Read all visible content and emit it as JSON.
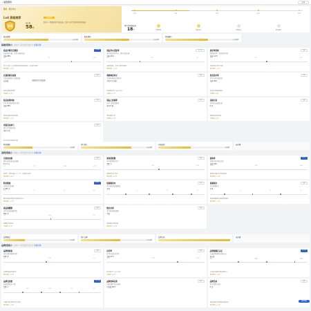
{
  "topbar": {
    "back": "‹ 返回服务",
    "share": "分享"
  },
  "hero": {
    "tag": "我的 · 成长中心",
    "name": "Lv4 高级商家",
    "badge": "V4",
    "score_label": "成长值",
    "score": "58",
    "score_unit": "分",
    "benefit": "权益说明",
    "note": "距离下一等级还需提升成长值，完成下方任务即可获得更多权益",
    "steps": [
      "Lv1",
      "Lv2",
      "Lv3",
      "Lv4",
      "Lv5"
    ],
    "steps_done": 4,
    "progress": 0.34,
    "points_label": "本月可领取权益",
    "points": "18",
    "points_unit": "个",
    "perks": [
      "专属客服",
      "流量扶持",
      "活动报名",
      "更多权益"
    ]
  },
  "group1": {
    "header": "基础经营能力",
    "sub": "完成以下任务提升成长分",
    "link": "查看详情",
    "bars": [
      {
        "label": "商品质量",
        "value": "12/20分",
        "pct": 0.6
      },
      {
        "label": "服务体验",
        "value": "15/25分",
        "pct": 0.6
      },
      {
        "label": "物流履约",
        "value": "17/30分",
        "pct": 0.58
      }
    ],
    "cards": [
      {
        "title": "商品详情页完整度",
        "desc": "完善商品主图、详情与规格信息",
        "metric": "当前 68%",
        "btn": "去完善",
        "ghost": false,
        "ticks": [
          "50",
          "80",
          "100"
        ],
        "points": [
          0.72
        ],
        "foot": "近7天已有 128 家同类商家完成该任务，完成后可提升",
        "gold": "预计提升 +3 分"
      },
      {
        "title": "商品评价回复率",
        "desc": "及时回复买家评价，提升店铺口碑",
        "metric": "当前 42%",
        "btn": "去回复",
        "ghost": true,
        "ticks": [
          "30",
          "60",
          "90"
        ],
        "points": [
          0.35
        ],
        "foot": "回复率越高，买家下单转化越好",
        "gold": "预计提升 +2 分"
      },
      {
        "title": "退货率控制",
        "desc": "降低退货率，保持良好经营",
        "metric": "当前 3.2%",
        "btn": "查看",
        "ghost": true,
        "ticks": [
          "1%",
          "3%",
          "5%"
        ],
        "points": [
          0.6
        ],
        "foot": "退货率低于同行均值",
        "gold": "预计提升 +2 分"
      },
      {
        "title": "店铺装修完成度",
        "desc": "完善店铺首页与品牌形象",
        "metric": "已完成",
        "btn": "查看",
        "ghost": true,
        "mid": "店铺首页已完成装修",
        "foot": "保持店铺形象更新",
        "gold": "已获得 +3 分"
      },
      {
        "title": "客服响应时长",
        "desc": "3分钟内响应买家咨询",
        "metric": "平均 2.1 分钟",
        "btn": "查看",
        "ghost": true,
        "foot": "响应速度优于 85% 同行",
        "gold": "已获得 +2 分"
      },
      {
        "title": "发货及时率",
        "desc": "48小时内完成发货",
        "metric": "当前 96%",
        "btn": "查看",
        "ghost": true,
        "foot": "发货及时率表现良好",
        "gold": "已获得 +4 分"
      },
      {
        "title": "售后处理时效",
        "desc": "24小时内处理售后申请",
        "metric": "当前 88%",
        "btn": "查看",
        "ghost": true,
        "foot": "建议加快售后处理速度",
        "gold": "预计提升 +1 分"
      },
      {
        "title": "商品上新频率",
        "desc": "每月上新商品数量",
        "metric": "本月 6 款",
        "btn": "查看",
        "ghost": true,
        "foot": "保持规律上新",
        "gold": "已获得 +2 分"
      },
      {
        "title": "违规记录",
        "desc": "近90天无违规记录",
        "metric": "0 次",
        "btn": "查看",
        "ghost": true,
        "foot": "继续保持良好经营",
        "gold": "已获得 +5 分"
      },
      {
        "title": "营销活动参与",
        "desc": "参与平台营销活动",
        "metric": "本月 2 次",
        "btn": "查看",
        "ghost": true,
        "foot": "参与更多活动获得流量",
        "gold": "预计提升 +2 分"
      }
    ]
  },
  "group2": {
    "header": "进阶经营能力",
    "sub": "完成以下任务提升成长分",
    "link": "查看详情",
    "bars": [
      {
        "label": "经营规模",
        "value": "8/20分",
        "pct": 0.4
      },
      {
        "label": "用户增长",
        "value": "14/20分",
        "pct": 0.7
      },
      {
        "label": "内容运营",
        "value": "9/20分",
        "pct": 0.45
      },
      {
        "label": "未开通",
        "value": "",
        "pct": 0
      }
    ],
    "cards": [
      {
        "title": "月度成交额",
        "desc": "提升店铺月度成交规模",
        "metric": "¥ 2.3 万",
        "btn": "查看",
        "ghost": true,
        "ticks": [
          "1万",
          "5万",
          "10万",
          "20万"
        ],
        "points": [],
        "foot": "距离下一档位还差 ¥ 2.7 万，完成后可提升",
        "gold": "预计提升 +4 分"
      },
      {
        "title": "新客获取数",
        "desc": "本月新增购买用户",
        "metric": "326 人",
        "btn": "查看",
        "ghost": true,
        "ticks": [
          "100",
          "300",
          "500"
        ],
        "points": [
          0.55
        ],
        "foot": "新客增长优于同行",
        "gold": "预计提升 +2 分"
      },
      {
        "title": "复购率",
        "desc": "老客户再次购买比例",
        "metric": "当前 18%",
        "btn": "去提升",
        "ghost": false,
        "ticks": [
          "10%",
          "20%",
          "30%"
        ],
        "points": [],
        "foot": "复购率可通过会员运营提升",
        "gold": "预计提升 +3 分"
      },
      {
        "title": "粉丝数量",
        "desc": "店铺关注粉丝数",
        "metric": "1,284 人",
        "btn": "去提升",
        "ghost": false,
        "ticks": [
          "500",
          "1k",
          "2k",
          "5k"
        ],
        "points": [],
        "foot": "通过内容运营吸引更多粉丝关注",
        "gold": "预计提升 +2 分"
      },
      {
        "title": "短视频发布",
        "desc": "本月发布短视频数量",
        "metric": "4 条",
        "btn": "查看",
        "ghost": true,
        "ticks": [
          "2",
          "5",
          "10",
          "20"
        ],
        "points": [
          0.2,
          0.45,
          0.7,
          0.9
        ],
        "foot": "",
        "gold": ""
      },
      {
        "title": "直播场次",
        "desc": "本月直播场次",
        "metric": "2 场",
        "btn": "查看",
        "ghost": true,
        "ticks": [
          "1",
          "4",
          "8",
          "12"
        ],
        "points": [
          0.15,
          0.45,
          0.75
        ],
        "foot": "保持直播频率可获得更多曝光",
        "gold": "预计提升 +2 分"
      },
      {
        "title": "商品收藏数",
        "desc": "本月商品被收藏次数",
        "metric": "892 次",
        "btn": "查看",
        "ghost": true,
        "ticks": [
          "200",
          "500",
          "1k"
        ],
        "points": [
          0.5
        ],
        "foot": "收藏转化率良好",
        "gold": "已获得 +2 分"
      },
      {
        "title": "图文内容",
        "desc": "本月发布图文数量",
        "metric": "3 篇",
        "btn": "查看",
        "ghost": true,
        "foot": "持续输出优质内容",
        "gold": "预计提升 +1 分"
      }
    ]
  },
  "group3": {
    "header": "品牌经营能力",
    "sub": "完成以下任务提升成长分",
    "link": "查看详情",
    "bars": [
      {
        "label": "品牌建设",
        "value": "6/20分",
        "pct": 0.3
      },
      {
        "label": "用户口碑",
        "value": "11/20分",
        "pct": 0.55
      },
      {
        "label": "品牌认证",
        "value": "",
        "pct": 1.0
      },
      {
        "label": "未开通",
        "value": "",
        "pct": 0
      }
    ],
    "cards": [
      {
        "title": "品牌搜索量",
        "desc": "本月品牌词搜索次数",
        "metric": "426 次",
        "btn": "查看",
        "ghost": true,
        "ticks": [
          "100",
          "500",
          "1k"
        ],
        "points": [
          0.45
        ],
        "foot": "品牌搜索量持续增长",
        "gold": "预计提升 +2 分"
      },
      {
        "title": "好评率",
        "desc": "近30天商品好评率",
        "metric": "当前 97%",
        "btn": "查看",
        "ghost": true,
        "ticks": [
          "90%",
          "95%",
          "99%"
        ],
        "points": [
          0.75
        ],
        "foot": "好评率优于 90% 同行",
        "gold": "已获得 +3 分"
      },
      {
        "title": "品牌旗舰店认证",
        "desc": "完成品牌旗舰店资质认证",
        "metric": "未认证",
        "btn": "去认证",
        "ghost": false,
        "ticks": [
          "提交",
          "审核",
          "完成"
        ],
        "points": [
          0.3,
          0.6,
          0.9
        ],
        "foot": "认证后可获得专属品牌标识",
        "gold": "预计提升 +5 分"
      },
      {
        "title": "品牌会员数",
        "desc": "店铺品牌会员人数",
        "metric": "168 人",
        "btn": "去开通",
        "ghost": false,
        "ticks": [
          "100",
          "300",
          "500",
          "1k",
          "2k"
        ],
        "points": [
          0.2,
          0.4,
          0.6,
          0.8
        ],
        "foot": "开通会员体系提升用户粘性",
        "gold": "预计提升 +3 分"
      },
      {
        "title": "品牌故事完善",
        "desc": "完善品牌介绍与故事",
        "metric": "已完成 60%",
        "btn": "查看",
        "ghost": true,
        "foot": "",
        "gold": ""
      },
      {
        "title": "品牌活动",
        "desc": "参与品牌日活动",
        "metric": "0 次",
        "btn": "查看",
        "ghost": true,
        "foot": "报名品牌日活动获得流量扶持",
        "gold": "预计提升 +2 分"
      }
    ]
  },
  "fab": "联系客服",
  "colors": {
    "accent": "#2c5fd6",
    "gold": "#e7b93b",
    "gold_text": "#c48a14"
  }
}
